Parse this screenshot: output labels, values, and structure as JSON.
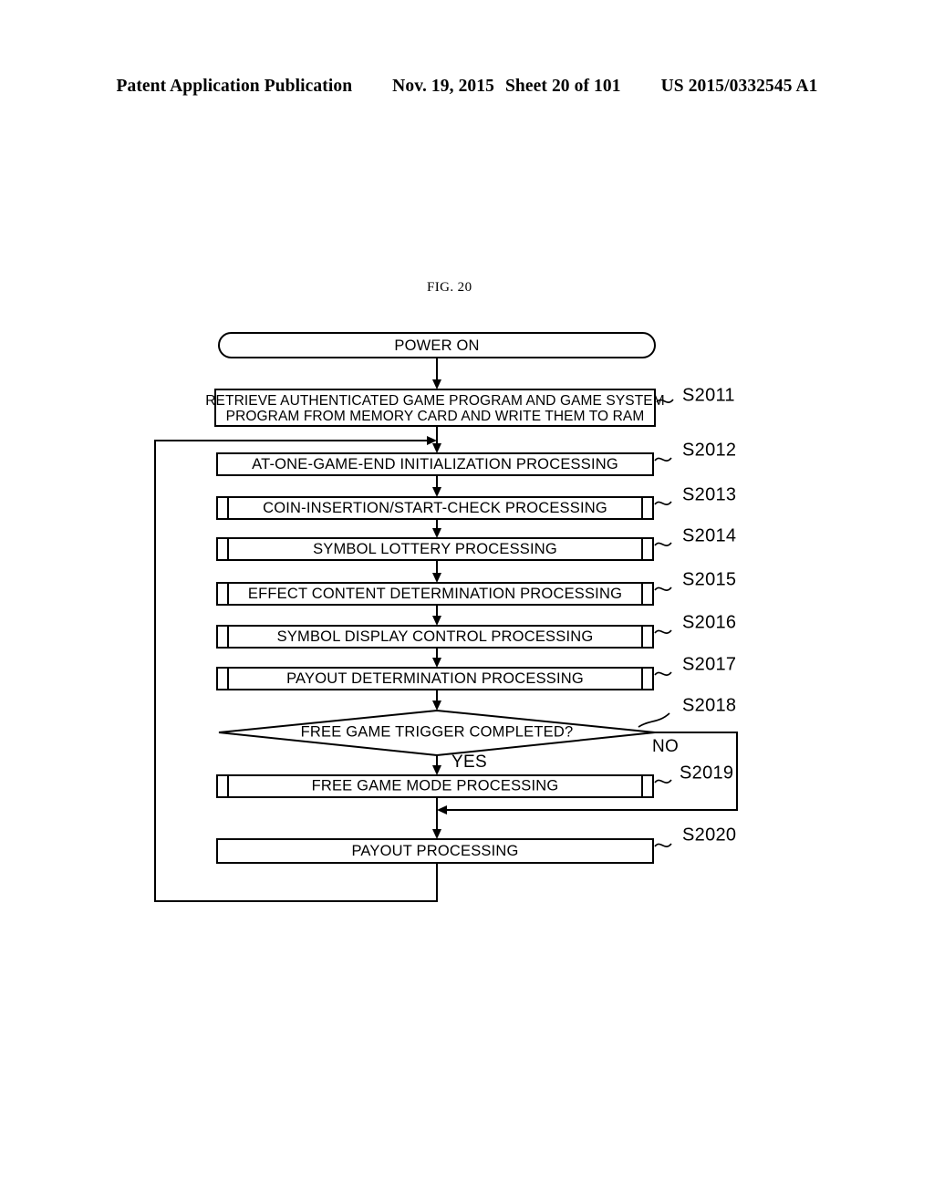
{
  "header": {
    "publication": "Patent Application Publication",
    "date": "Nov. 19, 2015",
    "sheet": "Sheet 20 of 101",
    "number": "US 2015/0332545 A1"
  },
  "figure": {
    "caption": "FIG. 20"
  },
  "flowchart": {
    "start": {
      "label": "POWER ON",
      "shape": "terminator"
    },
    "steps": [
      {
        "id": "S2011",
        "shape": "process",
        "lines": [
          "RETRIEVE AUTHENTICATED GAME PROGRAM AND GAME SYSTEM",
          "PROGRAM FROM MEMORY CARD AND WRITE THEM TO RAM"
        ]
      },
      {
        "id": "S2012",
        "shape": "process",
        "lines": [
          "AT-ONE-GAME-END INITIALIZATION PROCESSING"
        ]
      },
      {
        "id": "S2013",
        "shape": "predefined-process",
        "lines": [
          "COIN-INSERTION/START-CHECK PROCESSING"
        ]
      },
      {
        "id": "S2014",
        "shape": "predefined-process",
        "lines": [
          "SYMBOL LOTTERY PROCESSING"
        ]
      },
      {
        "id": "S2015",
        "shape": "predefined-process",
        "lines": [
          "EFFECT CONTENT DETERMINATION PROCESSING"
        ]
      },
      {
        "id": "S2016",
        "shape": "predefined-process",
        "lines": [
          "SYMBOL DISPLAY CONTROL PROCESSING"
        ]
      },
      {
        "id": "S2017",
        "shape": "predefined-process",
        "lines": [
          "PAYOUT DETERMINATION PROCESSING"
        ]
      },
      {
        "id": "S2018",
        "shape": "decision",
        "lines": [
          "FREE GAME TRIGGER COMPLETED?"
        ]
      },
      {
        "id": "S2019",
        "shape": "predefined-process",
        "lines": [
          "FREE GAME MODE PROCESSING"
        ]
      },
      {
        "id": "S2020",
        "shape": "process",
        "lines": [
          "PAYOUT PROCESSING"
        ]
      }
    ],
    "branches": {
      "yes": "YES",
      "no": "NO"
    }
  }
}
